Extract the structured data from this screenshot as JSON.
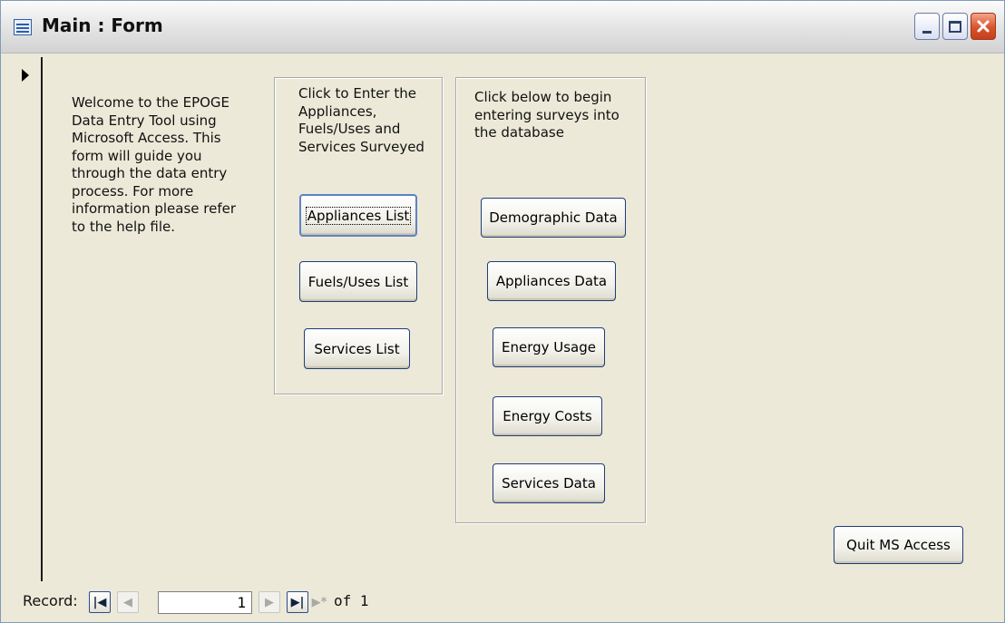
{
  "window": {
    "title": "Main : Form"
  },
  "welcome_text": "Welcome to the EPOGE\nData Entry Tool using\nMicrosoft Access.  This\nform will guide you\nthrough the data entry\nprocess.  For more\ninformation please refer\nto the help file.",
  "lists_section": {
    "heading": "Click to Enter the\nAppliances,\nFuels/Uses and\nServices Surveyed",
    "buttons": [
      {
        "label": "Appliances List"
      },
      {
        "label": "Fuels/Uses List"
      },
      {
        "label": "Services List"
      }
    ]
  },
  "surveys_section": {
    "heading": "Click below to begin\nentering surveys into\nthe database",
    "buttons": [
      {
        "label": "Demographic Data"
      },
      {
        "label": "Appliances Data"
      },
      {
        "label": "Energy Usage"
      },
      {
        "label": "Energy Costs"
      },
      {
        "label": "Services Data"
      }
    ]
  },
  "quit_button": {
    "label": "Quit MS Access"
  },
  "navigation": {
    "record_label": "Record:",
    "current_record": "1",
    "total_text": "of 1",
    "first_icon": "first-record-icon",
    "prev_icon": "previous-record-icon",
    "next_icon": "next-record-icon",
    "last_icon": "last-record-icon",
    "new_icon": "new-record-icon"
  }
}
